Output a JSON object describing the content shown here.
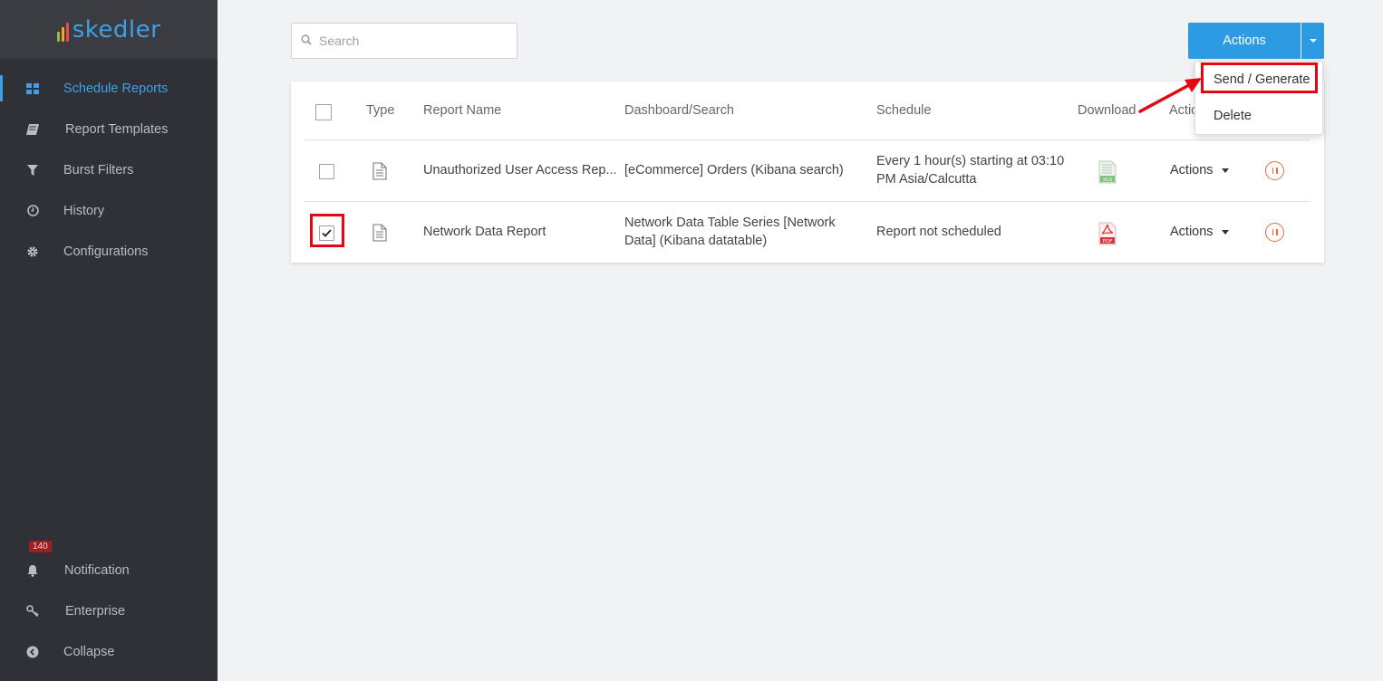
{
  "app": {
    "logo_text": "skedler"
  },
  "sidebar": {
    "items": [
      {
        "label": "Schedule Reports",
        "icon": "grid-icon",
        "active": true
      },
      {
        "label": "Report Templates",
        "icon": "book-icon"
      },
      {
        "label": "Burst Filters",
        "icon": "filter-icon"
      },
      {
        "label": "History",
        "icon": "clock-icon"
      },
      {
        "label": "Configurations",
        "icon": "gear-icon"
      }
    ],
    "bottom_items": [
      {
        "label": "Notification",
        "icon": "bell-icon",
        "badge": "140"
      },
      {
        "label": "Enterprise",
        "icon": "key-icon"
      },
      {
        "label": "Collapse",
        "icon": "chevron-left-circle-icon"
      }
    ]
  },
  "search": {
    "placeholder": "Search",
    "value": ""
  },
  "toolbar": {
    "actions_label": "Actions"
  },
  "actions_menu": {
    "items": [
      "Send / Generate",
      "Delete"
    ],
    "highlighted": "Send / Generate"
  },
  "table": {
    "columns": [
      "Type",
      "Report Name",
      "Dashboard/Search",
      "Schedule",
      "Download",
      "Actions"
    ],
    "rows": [
      {
        "checked": false,
        "report_name": "Unauthorized User Access Rep...",
        "dashboard_line1": "[eCommerce] Orders (Kibana search)",
        "dashboard_line2": "",
        "schedule_line1": "Every 1 hour(s) starting at 03:10",
        "schedule_line2": "PM Asia/Calcutta",
        "download": {
          "format": "XLS",
          "color": "#7cc47a"
        },
        "actions_label": "Actions"
      },
      {
        "checked": true,
        "report_name": "Network Data Report",
        "dashboard_line1": "Network Data Table Series [Network",
        "dashboard_line2": "Data] (Kibana datatable)",
        "schedule_line1": "Report not scheduled",
        "schedule_line2": "",
        "download": {
          "format": "PDF",
          "color": "#d9373f"
        },
        "actions_label": "Actions"
      }
    ]
  },
  "colors": {
    "accent": "#2d9be3",
    "sidebar_bg": "#2f3136",
    "highlight": "#e30613",
    "pause": "#ec6a3d"
  }
}
